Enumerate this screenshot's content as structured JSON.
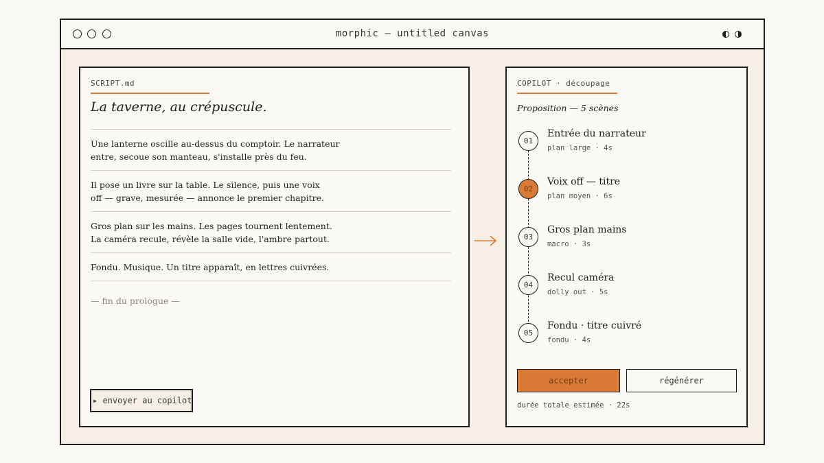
{
  "window": {
    "title": "morphic — untitled canvas"
  },
  "theme_icons": [
    "contrast-icon",
    "contrast-alt-icon"
  ],
  "script": {
    "file_label": "SCRIPT.md",
    "title": "La taverne, au crépuscule.",
    "paragraphs": [
      {
        "lines": [
          "Une lanterne oscille au-dessus du comptoir. Le narrateur",
          "entre, secoue son manteau, s'installe près du feu."
        ]
      },
      {
        "lines": [
          "Il pose un livre sur la table. Le silence, puis une voix",
          "off — grave, mesurée — annonce le premier chapitre."
        ]
      },
      {
        "lines": [
          "Gros plan sur les mains. Les pages tournent lentement.",
          "La caméra recule, révèle la salle vide, l'ambre partout."
        ]
      },
      {
        "lines": [
          "Fondu. Musique. Un titre apparaît, en lettres cuivrées."
        ]
      }
    ],
    "ending": "— fin du prologue —",
    "send_button": "▸ envoyer au copilot"
  },
  "copilot": {
    "label": "COPILOT · découpage",
    "proposal": "Proposition — 5 scènes",
    "scenes": [
      {
        "num": "01",
        "title": "Entrée du narrateur",
        "meta": "plan large · 4s"
      },
      {
        "num": "02",
        "title": "Voix off — titre",
        "meta": "plan moyen · 6s"
      },
      {
        "num": "03",
        "title": "Gros plan mains",
        "meta": "macro · 3s"
      },
      {
        "num": "04",
        "title": "Recul caméra",
        "meta": "dolly out · 5s"
      },
      {
        "num": "05",
        "title": "Fondu · titre cuivré",
        "meta": "fondu · 4s"
      }
    ],
    "active_scene": "02",
    "accept_button": "accepter",
    "regenerate_button": "régénérer",
    "total": "durée totale estimée · 22s"
  },
  "colors": {
    "accent": "#d97b35",
    "ink": "#1e1e1e",
    "canvas": "#f5eee4",
    "paper": "#fbf9f5"
  }
}
